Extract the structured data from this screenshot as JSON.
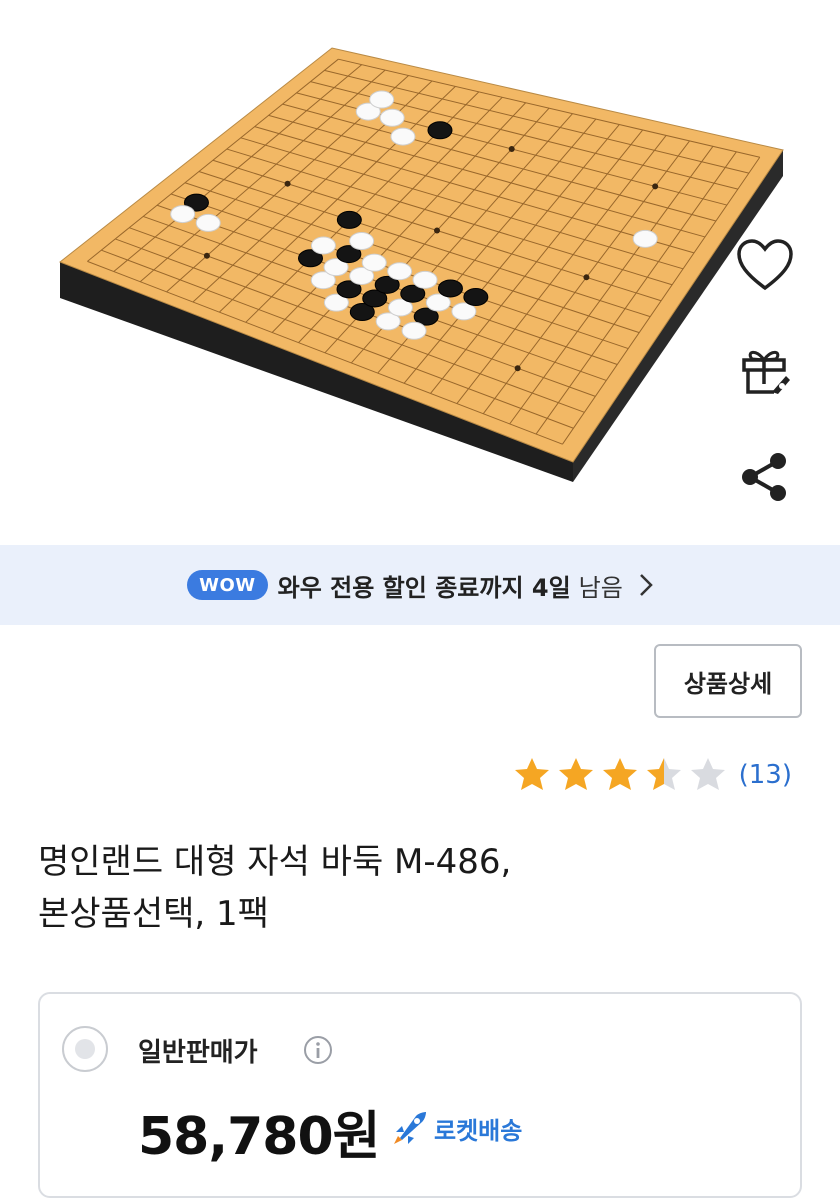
{
  "product_image": {
    "alt_icon": "go-board-product-image"
  },
  "side_actions": [
    {
      "name": "heart-icon"
    },
    {
      "name": "gift-icon"
    },
    {
      "name": "share-icon"
    }
  ],
  "wow_banner": {
    "badge": "WOW",
    "text": "와우 전용 할인 종료까지 4일",
    "suffix": "남음"
  },
  "detail_button": {
    "label": "상품상세"
  },
  "rating": {
    "value": 3.5,
    "max": 5,
    "count_label": "(13)",
    "star_color": "#f5a623",
    "empty_color": "#d9dbe0"
  },
  "product": {
    "title_line1": "명인랜드 대형 자석 바둑 M-486,",
    "title_line2": "본상품선택, 1팩"
  },
  "price_option": {
    "label": "일반판매가",
    "price": "58,780원",
    "delivery": "로켓배송",
    "delivery_color": "#2a78d8"
  }
}
